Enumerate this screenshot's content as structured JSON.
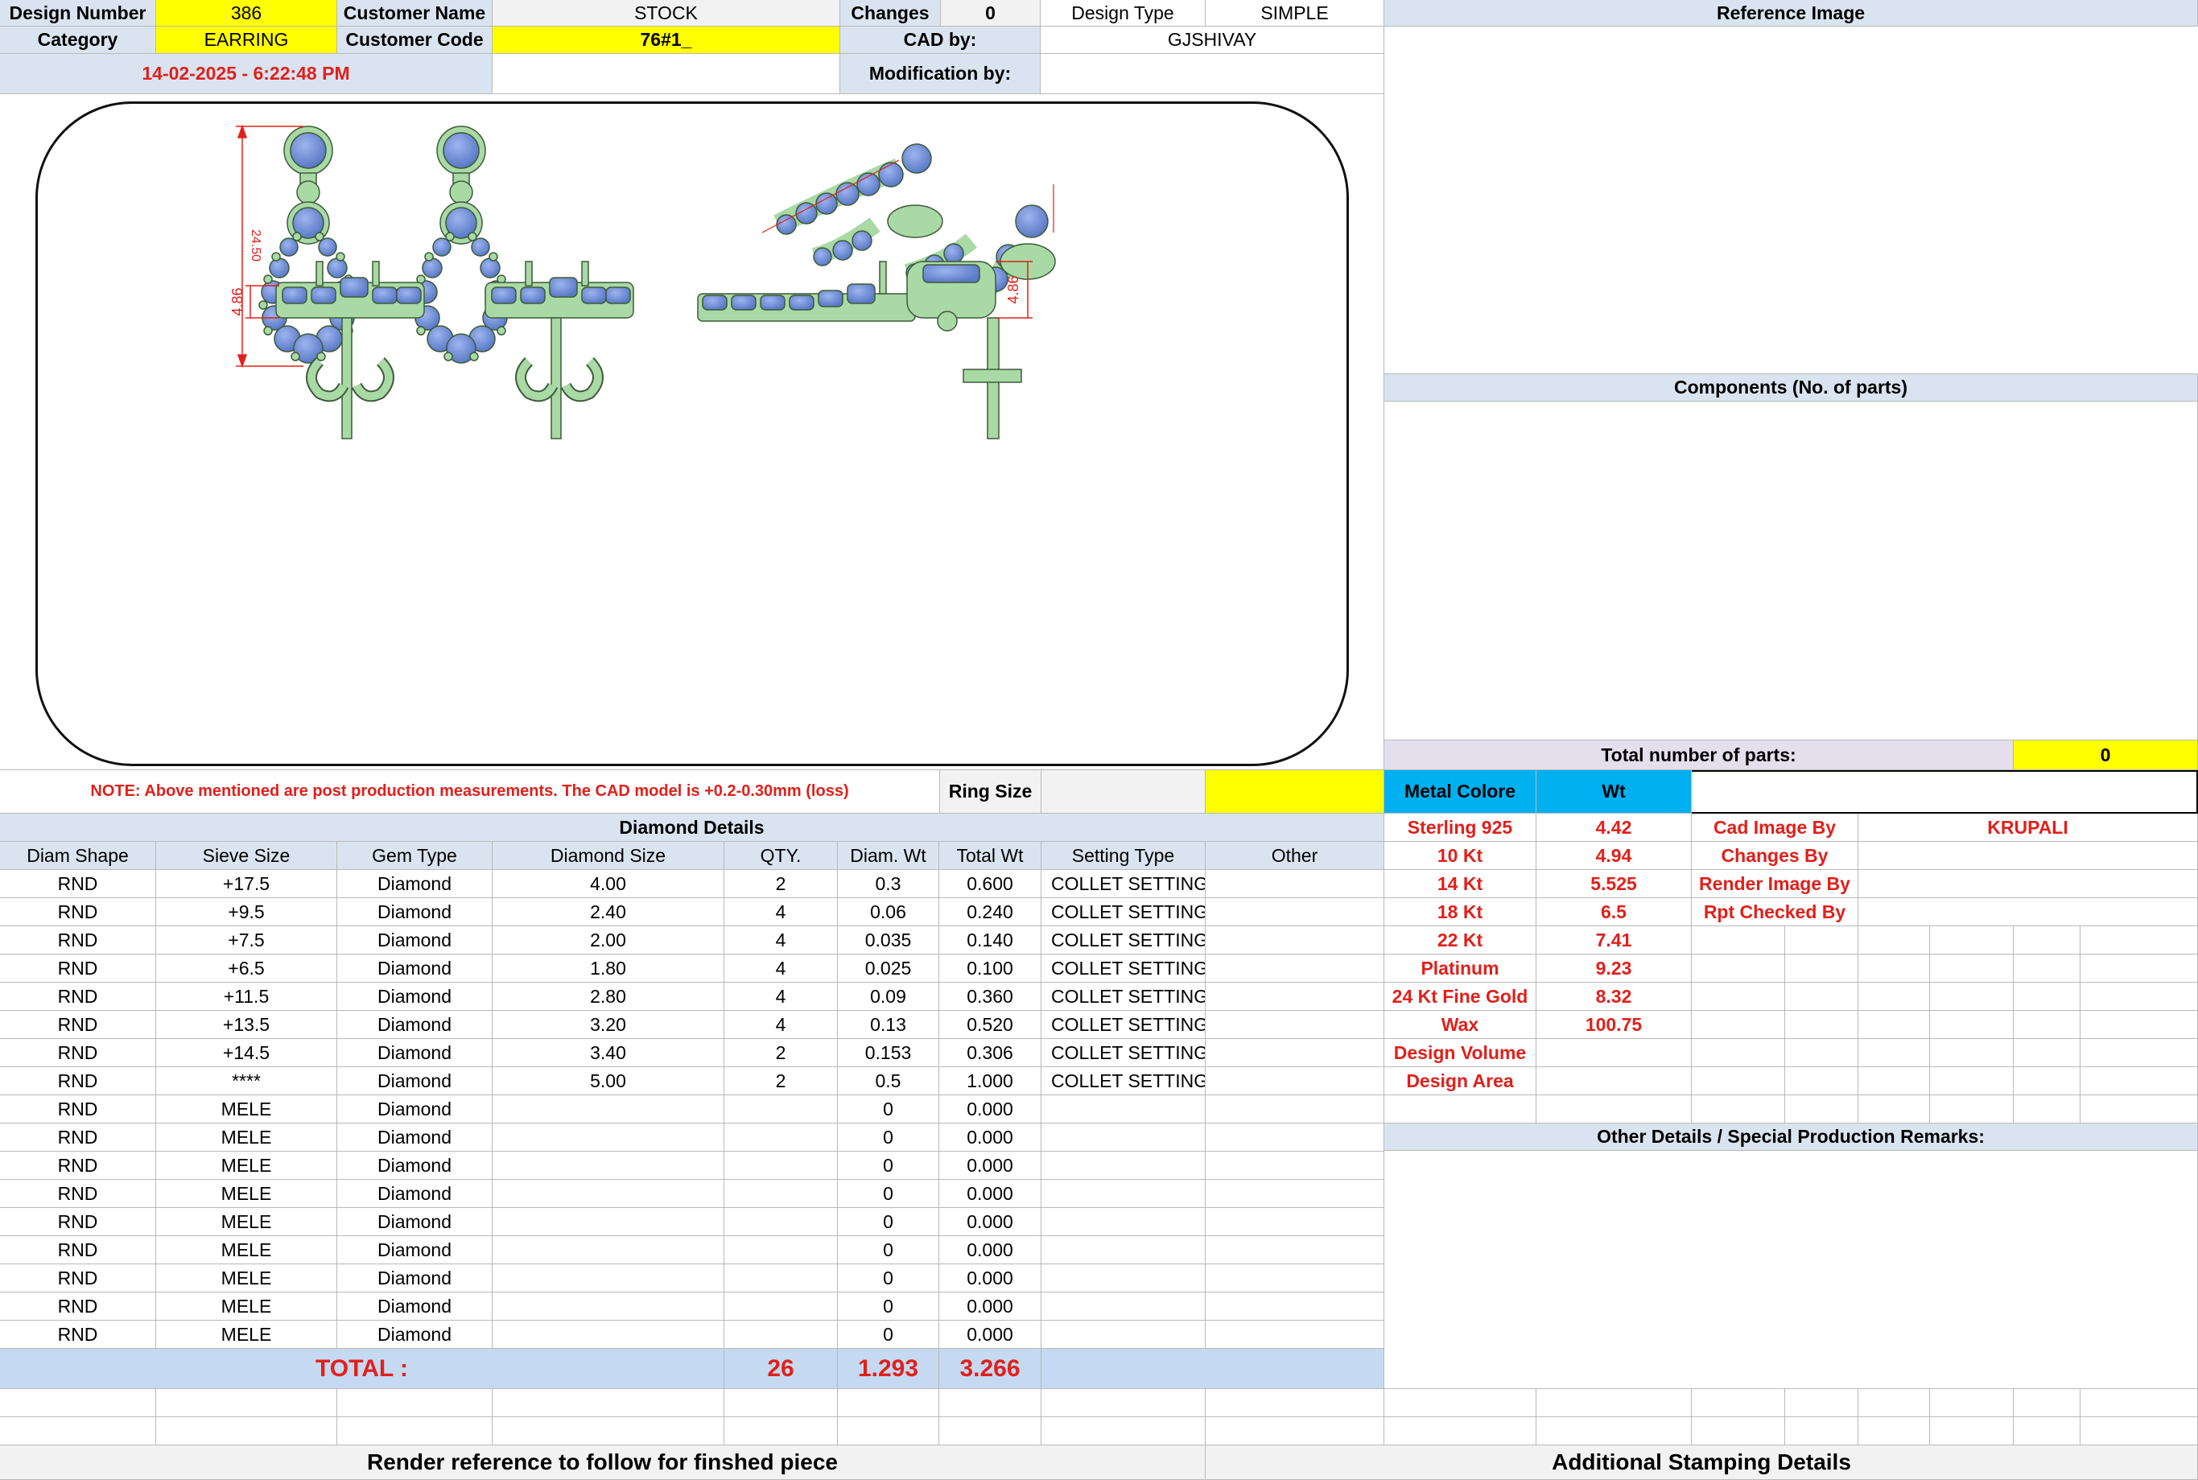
{
  "header": {
    "design_number_label": "Design Number",
    "design_number": "386",
    "customer_name_label": "Customer Name",
    "customer_name": "STOCK",
    "changes_label": "Changes",
    "changes": "0",
    "design_type_label": "Design Type",
    "design_type": "SIMPLE",
    "category_label": "Category",
    "category": "EARRING",
    "customer_code_label": "Customer Code",
    "customer_code": "76#1_",
    "cad_by_label": "CAD by:",
    "cad_by": "GJSHIVAY",
    "timestamp": "14-02-2025 - 6:22:48 PM",
    "modification_by_label": "Modification by:",
    "modification_by": ""
  },
  "drawing": {
    "dim_height": "24.50",
    "dim_side_a": "4.86",
    "dim_side_b": "4.86"
  },
  "right_panel": {
    "reference_image": "Reference Image",
    "components": "Components (No. of parts)",
    "total_parts_label": "Total number of parts:",
    "total_parts": "0"
  },
  "note": {
    "text": "NOTE: Above mentioned are post production measurements. The CAD model is +0.2-0.30mm (loss)",
    "ring_size_label": "Ring Size",
    "ring_size": ""
  },
  "metal": {
    "color_label": "Metal Colore",
    "wt_label": "Wt",
    "rows": [
      {
        "metal": "Sterling 925",
        "wt": "4.42"
      },
      {
        "metal": "10 Kt",
        "wt": "4.94"
      },
      {
        "metal": "14 Kt",
        "wt": "5.525"
      },
      {
        "metal": "18 Kt",
        "wt": "6.5"
      },
      {
        "metal": "22 Kt",
        "wt": "7.41"
      },
      {
        "metal": "Platinum",
        "wt": "9.23"
      },
      {
        "metal": "24 Kt Fine Gold",
        "wt": "8.32"
      },
      {
        "metal": "Wax",
        "wt": "100.75"
      },
      {
        "metal": "Design Volume",
        "wt": ""
      },
      {
        "metal": "Design Area",
        "wt": ""
      }
    ]
  },
  "credits": [
    {
      "label": "Cad Image By",
      "value": "KRUPALI"
    },
    {
      "label": "Changes By",
      "value": ""
    },
    {
      "label": "Render Image By",
      "value": ""
    },
    {
      "label": "Rpt Checked By",
      "value": ""
    }
  ],
  "other_details_label": "Other Details / Special Production Remarks:",
  "diamond": {
    "title": "Diamond Details",
    "columns": [
      "Diam Shape",
      "Sieve Size",
      "Gem Type",
      "Diamond Size",
      "QTY.",
      "Diam. Wt",
      "Total Wt",
      "Setting Type",
      "Other"
    ],
    "rows": [
      [
        "RND",
        "+17.5",
        "Diamond",
        "4.00",
        "2",
        "0.3",
        "0.600",
        "COLLET SETTING",
        ""
      ],
      [
        "RND",
        "+9.5",
        "Diamond",
        "2.40",
        "4",
        "0.06",
        "0.240",
        "COLLET SETTING",
        ""
      ],
      [
        "RND",
        "+7.5",
        "Diamond",
        "2.00",
        "4",
        "0.035",
        "0.140",
        "COLLET SETTING",
        ""
      ],
      [
        "RND",
        "+6.5",
        "Diamond",
        "1.80",
        "4",
        "0.025",
        "0.100",
        "COLLET SETTING",
        ""
      ],
      [
        "RND",
        "+11.5",
        "Diamond",
        "2.80",
        "4",
        "0.09",
        "0.360",
        "COLLET SETTING",
        ""
      ],
      [
        "RND",
        "+13.5",
        "Diamond",
        "3.20",
        "4",
        "0.13",
        "0.520",
        "COLLET SETTING",
        ""
      ],
      [
        "RND",
        "+14.5",
        "Diamond",
        "3.40",
        "2",
        "0.153",
        "0.306",
        "COLLET SETTING",
        ""
      ],
      [
        "RND",
        "****",
        "Diamond",
        "5.00",
        "2",
        "0.5",
        "1.000",
        "COLLET SETTING",
        ""
      ],
      [
        "RND",
        "MELE",
        "Diamond",
        "",
        "",
        "0",
        "0.000",
        "",
        ""
      ],
      [
        "RND",
        "MELE",
        "Diamond",
        "",
        "",
        "0",
        "0.000",
        "",
        ""
      ],
      [
        "RND",
        "MELE",
        "Diamond",
        "",
        "",
        "0",
        "0.000",
        "",
        ""
      ],
      [
        "RND",
        "MELE",
        "Diamond",
        "",
        "",
        "0",
        "0.000",
        "",
        ""
      ],
      [
        "RND",
        "MELE",
        "Diamond",
        "",
        "",
        "0",
        "0.000",
        "",
        ""
      ],
      [
        "RND",
        "MELE",
        "Diamond",
        "",
        "",
        "0",
        "0.000",
        "",
        ""
      ],
      [
        "RND",
        "MELE",
        "Diamond",
        "",
        "",
        "0",
        "0.000",
        "",
        ""
      ],
      [
        "RND",
        "MELE",
        "Diamond",
        "",
        "",
        "0",
        "0.000",
        "",
        ""
      ],
      [
        "RND",
        "MELE",
        "Diamond",
        "",
        "",
        "0",
        "0.000",
        "",
        ""
      ]
    ],
    "total_label": "TOTAL :",
    "total_qty": "26",
    "total_diam_wt": "1.293",
    "total_wt": "3.266"
  },
  "footer": {
    "render_reference": "Render reference to follow for finshed piece",
    "stamping": "Additional Stamping Details"
  },
  "colors": {
    "header_blue": "#dae4f0",
    "highlight_yellow": "#ffff00",
    "metal_cyan": "#00b0f0",
    "total_blue": "#c5d9f1",
    "red_text": "#e0201b",
    "metal_green": "#a9d9a4",
    "stone_blue": "#6f8fd6"
  }
}
